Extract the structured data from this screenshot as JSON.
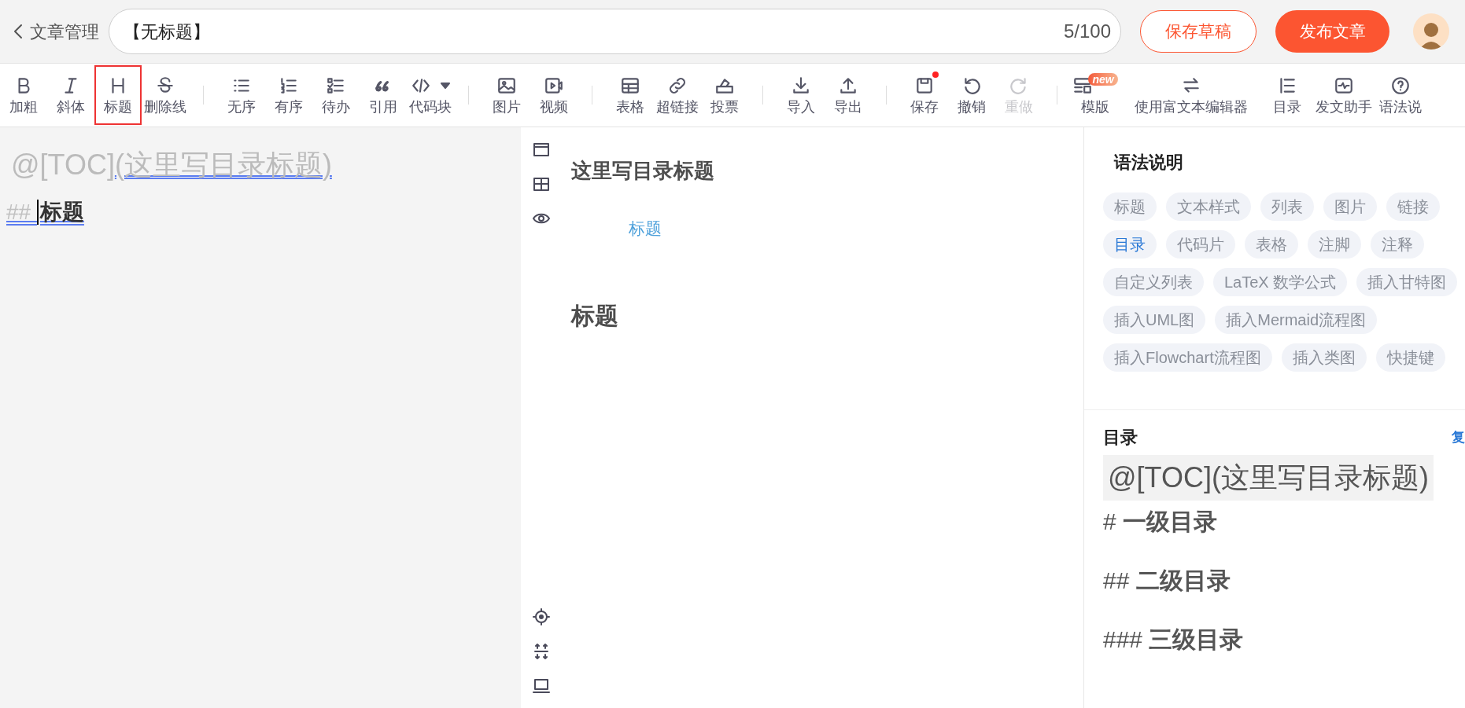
{
  "header": {
    "back_label": "文章管理",
    "title": "【无标题】",
    "count": "5/100",
    "save_draft": "保存草稿",
    "publish": "发布文章"
  },
  "toolbar": {
    "groups": [
      [
        {
          "label": "加粗",
          "selected": false,
          "disabled": false
        },
        {
          "label": "斜体",
          "selected": false,
          "disabled": false
        },
        {
          "label": "标题",
          "selected": true,
          "disabled": false
        },
        {
          "label": "删除线",
          "selected": false,
          "disabled": false
        }
      ],
      [
        {
          "label": "无序",
          "selected": false,
          "disabled": false
        },
        {
          "label": "有序",
          "selected": false,
          "disabled": false
        },
        {
          "label": "待办",
          "selected": false,
          "disabled": false
        },
        {
          "label": "引用",
          "selected": false,
          "disabled": false
        },
        {
          "label": "代码块",
          "selected": false,
          "disabled": false
        }
      ],
      [
        {
          "label": "图片",
          "selected": false,
          "disabled": false
        },
        {
          "label": "视频",
          "selected": false,
          "disabled": false
        }
      ],
      [
        {
          "label": "表格",
          "selected": false,
          "disabled": false
        },
        {
          "label": "超链接",
          "selected": false,
          "disabled": false
        },
        {
          "label": "投票",
          "selected": false,
          "disabled": false
        }
      ],
      [
        {
          "label": "导入",
          "selected": false,
          "disabled": false
        },
        {
          "label": "导出",
          "selected": false,
          "disabled": false
        }
      ],
      [
        {
          "label": "保存",
          "selected": false,
          "disabled": false,
          "dot": true
        },
        {
          "label": "撤销",
          "selected": false,
          "disabled": false
        },
        {
          "label": "重做",
          "selected": false,
          "disabled": true
        }
      ],
      [
        {
          "label": "模版",
          "selected": false,
          "disabled": false,
          "badge": "new"
        },
        {
          "label": "使用富文本编辑器",
          "selected": false,
          "disabled": false
        },
        {
          "label": "目录",
          "selected": false,
          "disabled": false
        },
        {
          "label": "发文助手",
          "selected": false,
          "disabled": false
        },
        {
          "label": "语法说",
          "selected": false,
          "disabled": false
        }
      ]
    ]
  },
  "editor": {
    "toc_mark": "@[TOC]",
    "toc_title": "(这里写目录标题)",
    "heading_marks": "##",
    "heading_text": "标题"
  },
  "preview": {
    "toc_title": "这里写目录标题",
    "toc_items": [
      "标题"
    ],
    "headings": [
      "标题"
    ]
  },
  "syntax_panel": {
    "title": "语法说明",
    "tags": [
      [
        {
          "label": "标题",
          "selected": false
        },
        {
          "label": "文本样式",
          "selected": false
        },
        {
          "label": "列表",
          "selected": false
        },
        {
          "label": "图片",
          "selected": false
        },
        {
          "label": "链接",
          "selected": false
        }
      ],
      [
        {
          "label": "目录",
          "selected": true
        },
        {
          "label": "代码片",
          "selected": false
        },
        {
          "label": "表格",
          "selected": false
        },
        {
          "label": "注脚",
          "selected": false
        },
        {
          "label": "注释",
          "selected": false
        }
      ],
      [
        {
          "label": "自定义列表",
          "selected": false
        },
        {
          "label": "LaTeX 数学公式",
          "selected": false
        },
        {
          "label": "插入甘特图",
          "selected": false
        }
      ],
      [
        {
          "label": "插入UML图",
          "selected": false
        },
        {
          "label": "插入Mermaid流程图",
          "selected": false
        }
      ],
      [
        {
          "label": "插入Flowchart流程图",
          "selected": false
        },
        {
          "label": "插入类图",
          "selected": false
        },
        {
          "label": "快捷键",
          "selected": false
        }
      ]
    ],
    "toc": {
      "title": "目录",
      "copy_link": "复",
      "code": "@[TOC](这里写目录标题)",
      "lines": [
        {
          "marks": "#",
          "text": "一级目录"
        },
        {
          "marks": "##",
          "text": "二级目录"
        },
        {
          "marks": "###",
          "text": "三级目录"
        }
      ]
    }
  }
}
